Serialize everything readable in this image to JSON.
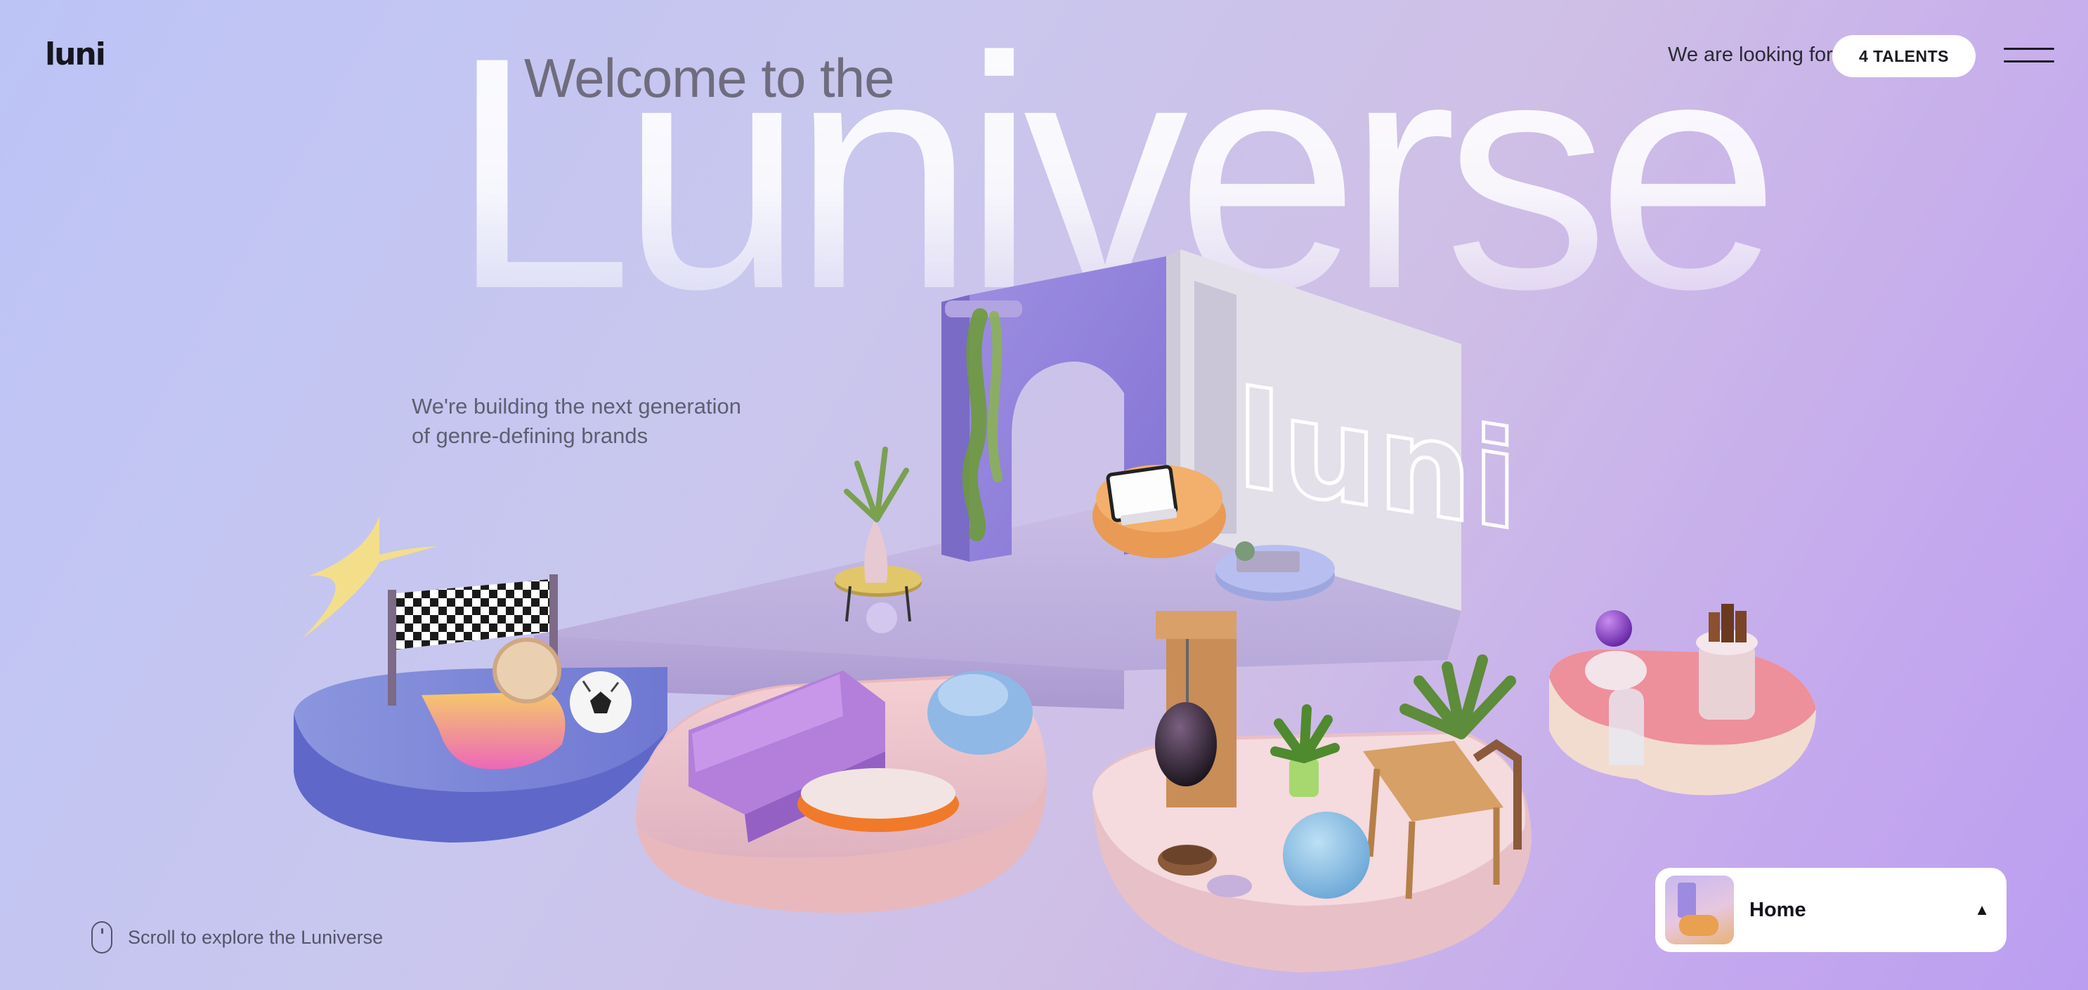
{
  "header": {
    "logo": "luni",
    "hiring_text": "We are looking for",
    "talents_button": "4 TALENTS",
    "menu_icon": "hamburger-menu-icon"
  },
  "hero": {
    "welcome": "Welcome to the",
    "big_word": "Luniverse",
    "tagline_line1": "We're building the next generation",
    "tagline_line2": "of genre-defining brands"
  },
  "scene": {
    "sign_text": "luni"
  },
  "scroll_hint": {
    "icon": "mouse-icon",
    "text": "Scroll to explore the Luniverse"
  },
  "room_nav": {
    "label": "Home",
    "chevron_icon": "chevron-up-icon"
  },
  "colors": {
    "bg_start": "#bcc4f6",
    "bg_end": "#bb9ef0",
    "text_dark": "#1a1a22",
    "button_bg": "#ffffff"
  }
}
